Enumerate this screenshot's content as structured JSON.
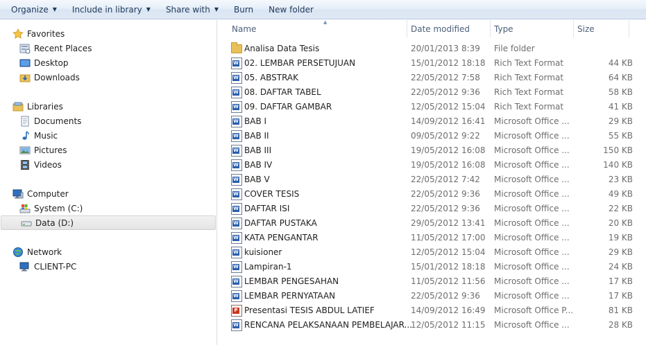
{
  "toolbar": {
    "organize": "Organize",
    "include_in_library": "Include in library",
    "share_with": "Share with",
    "burn": "Burn",
    "new_folder": "New folder"
  },
  "nav": {
    "favorites": "Favorites",
    "recent_places": "Recent Places",
    "desktop": "Desktop",
    "downloads": "Downloads",
    "libraries": "Libraries",
    "documents": "Documents",
    "music": "Music",
    "pictures": "Pictures",
    "videos": "Videos",
    "computer": "Computer",
    "system_c": "System (C:)",
    "data_d": "Data (D:)",
    "network": "Network",
    "client_pc": "CLIENT-PC"
  },
  "columns": {
    "name": "Name",
    "date_modified": "Date modified",
    "type": "Type",
    "size": "Size"
  },
  "files": [
    {
      "name": "Analisa Data Tesis",
      "date": "20/01/2013 8:39",
      "type": "File folder",
      "size": "",
      "icon": "folder-icon"
    },
    {
      "name": "02. LEMBAR PERSETUJUAN",
      "date": "15/01/2012 18:18",
      "type": "Rich Text Format",
      "size": "44 KB",
      "icon": "word-document-icon"
    },
    {
      "name": "05. ABSTRAK",
      "date": "22/05/2012 7:58",
      "type": "Rich Text Format",
      "size": "64 KB",
      "icon": "word-document-icon"
    },
    {
      "name": "08. DAFTAR TABEL",
      "date": "22/05/2012 9:36",
      "type": "Rich Text Format",
      "size": "58 KB",
      "icon": "word-document-icon"
    },
    {
      "name": "09. DAFTAR GAMBAR",
      "date": "12/05/2012 15:04",
      "type": "Rich Text Format",
      "size": "41 KB",
      "icon": "word-document-icon"
    },
    {
      "name": "BAB I",
      "date": "14/09/2012 16:41",
      "type": "Microsoft Office ...",
      "size": "29 KB",
      "icon": "word-document-icon"
    },
    {
      "name": "BAB II",
      "date": "09/05/2012 9:22",
      "type": "Microsoft Office ...",
      "size": "55 KB",
      "icon": "word-document-icon"
    },
    {
      "name": "BAB III",
      "date": "19/05/2012 16:08",
      "type": "Microsoft Office ...",
      "size": "150 KB",
      "icon": "word-document-icon"
    },
    {
      "name": "BAB IV",
      "date": "19/05/2012 16:08",
      "type": "Microsoft Office ...",
      "size": "140 KB",
      "icon": "word-document-icon"
    },
    {
      "name": "BAB V",
      "date": "22/05/2012 7:42",
      "type": "Microsoft Office ...",
      "size": "23 KB",
      "icon": "word-document-icon"
    },
    {
      "name": "COVER TESIS",
      "date": "22/05/2012 9:36",
      "type": "Microsoft Office ...",
      "size": "49 KB",
      "icon": "word-document-icon"
    },
    {
      "name": "DAFTAR ISI",
      "date": "22/05/2012 9:36",
      "type": "Microsoft Office ...",
      "size": "22 KB",
      "icon": "word-document-icon"
    },
    {
      "name": "DAFTAR PUSTAKA",
      "date": "29/05/2012 13:41",
      "type": "Microsoft Office ...",
      "size": "20 KB",
      "icon": "word-document-icon"
    },
    {
      "name": "KATA PENGANTAR",
      "date": "11/05/2012 17:00",
      "type": "Microsoft Office ...",
      "size": "19 KB",
      "icon": "word-document-icon"
    },
    {
      "name": "kuisioner",
      "date": "12/05/2012 15:04",
      "type": "Microsoft Office ...",
      "size": "29 KB",
      "icon": "word-document-icon"
    },
    {
      "name": "Lampiran-1",
      "date": "15/01/2012 18:18",
      "type": "Microsoft Office ...",
      "size": "24 KB",
      "icon": "word-document-icon"
    },
    {
      "name": "LEMBAR PENGESAHAN",
      "date": "11/05/2012 11:56",
      "type": "Microsoft Office ...",
      "size": "17 KB",
      "icon": "word-document-icon"
    },
    {
      "name": "LEMBAR PERNYATAAN",
      "date": "22/05/2012 9:36",
      "type": "Microsoft Office ...",
      "size": "17 KB",
      "icon": "word-document-icon"
    },
    {
      "name": "Presentasi TESIS ABDUL LATIEF",
      "date": "14/09/2012 16:49",
      "type": "Microsoft Office P...",
      "size": "81 KB",
      "icon": "powerpoint-icon"
    },
    {
      "name": "RENCANA PELAKSANAAN PEMBELAJAR...",
      "date": "12/05/2012 11:15",
      "type": "Microsoft Office ...",
      "size": "28 KB",
      "icon": "word-document-icon"
    }
  ]
}
